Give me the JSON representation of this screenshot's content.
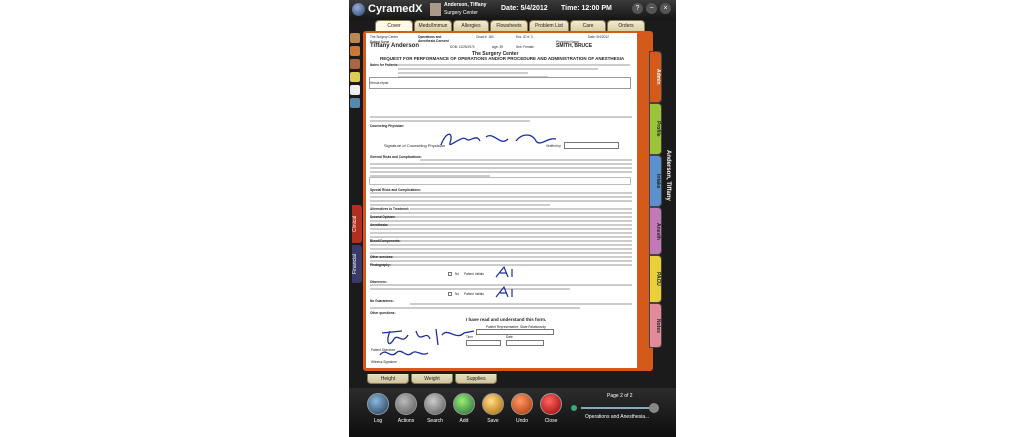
{
  "app": {
    "name": "CyramedX"
  },
  "user": {
    "name": "Anderson, Tiffany",
    "location": "Surgery Center"
  },
  "date_label": "Date: 5/4/2012",
  "time_label": "Time: 12:00 PM",
  "window_buttons": [
    "?",
    "−",
    "×"
  ],
  "top_tabs": [
    "Cover",
    "Meds/Immun",
    "Allergies",
    "Flowsheets",
    "Problem List",
    "Care",
    "Orders"
  ],
  "right_tabs": [
    "Admin",
    "Profile",
    "Intake",
    "Anesth",
    "PACU",
    "Notes"
  ],
  "left_side_tabs": [
    "Clinical",
    "Financial"
  ],
  "patient_tab": "Anderson, Tiffany",
  "bottom_tabs": [
    "Height",
    "Weight",
    "Supplies"
  ],
  "toolbar": [
    "Log",
    "Actions",
    "Search",
    "Add",
    "Save",
    "Undo",
    "Close"
  ],
  "page_indicator": "Page 2 of 2",
  "document_name": "Operations and Anesthesia...",
  "form": {
    "facility": "The Surgery Center",
    "form_name": "Operations and Anesthesia Consent",
    "chart": "Chart #: 163",
    "enc": "Enc. ID #: 3",
    "date": "Date: 5/4/2012",
    "patient_name_label": "Patient Name",
    "patient_name": "Tiffany Anderson",
    "dob": "DOB: 12/25/1972",
    "age": "Age: 39",
    "sex": "Sex: Female",
    "physician_label": "Physician Name",
    "physician": "SMITH, BRUCE",
    "title": "The Surgery Center",
    "subtitle": "REQUEST FOR PERFORMANCE OF OPERATIONS AND/OR PROCEDURE AND ADMINISTRATION OF ANESTHESIA",
    "procedure": "Hernia repair",
    "sig_counseling": "Signature of Counseling Physician",
    "verified": "Verified by",
    "patient_initials": "Patient Initials",
    "no": "No",
    "read_understand": "I have read and understand this form.",
    "rep_label": "Patient Representative, State Relationship",
    "time_label": "Time",
    "date_label": "Date",
    "patient_sig": "Patient Signature",
    "witness_sig": "Witness Signature",
    "sections": [
      "Notes for Patients:",
      "Counseling Physician:",
      "General Risks and Complications:",
      "Special Risks and Complications:",
      "Alternatives to Treatment:",
      "Second Opinion:",
      "Anesthesia:",
      "Blood/Components:",
      "Other services:",
      "Photography:",
      "Observers:",
      "No Guarantees:",
      "Other questions:"
    ]
  },
  "colors": {
    "frame": "#1b1b1b",
    "document_border": "#d35a1a",
    "accent": "#5a8fd0"
  }
}
